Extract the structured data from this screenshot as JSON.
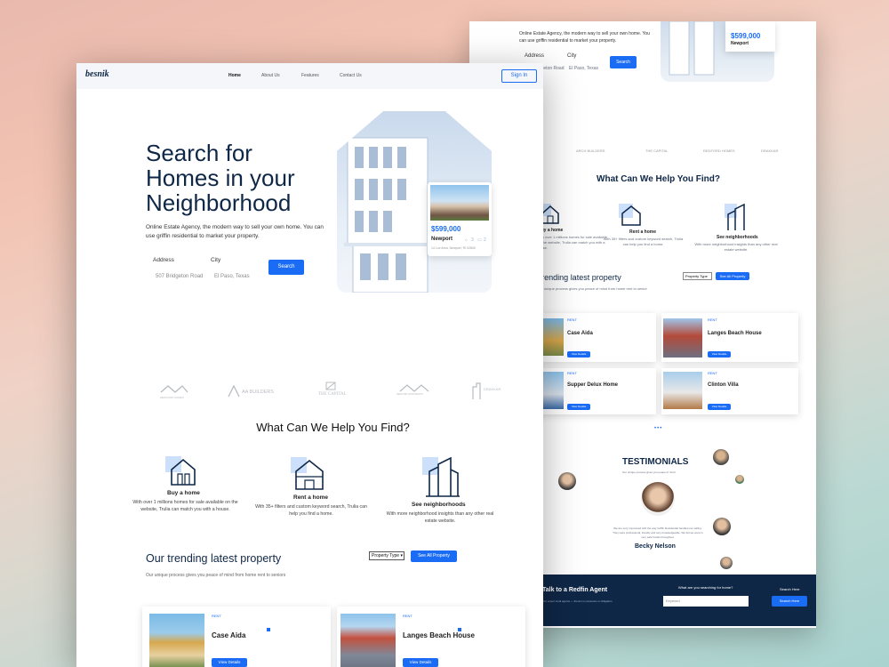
{
  "back": {
    "hero_text": "Online Estate Agency, the modern way to sell your own home. You can use griffin residential to market your property.",
    "address_label": "Address",
    "city_label": "City",
    "address_value": "507 Bridgeton Road",
    "city_value": "El Paso, Texas",
    "search_label": "Search",
    "price": "$599,000",
    "location": "Newport",
    "brands": [
      "ARCH BUILDERS",
      "THE CAPITAL",
      "REDFORD HOMES",
      "DRAKKAR"
    ],
    "help_title": "What Can We Help You Find?",
    "services": [
      {
        "title": "Buy a home",
        "desc": "With over 1 millions homes for sale available on the website, Trulia can match you with a house."
      },
      {
        "title": "Rent a home",
        "desc": "With 35+ filters and custom keyword search, Trulia can help you find a home."
      },
      {
        "title": "See neighborhoods",
        "desc": "With more neighborhood insights than any other real estate website."
      }
    ],
    "trending_title": "Trending latest property",
    "trending_sub": "Our unique process gives you peace of mind from home rent to senior",
    "property_type": "Property Type",
    "see_all": "See All Property",
    "listings": [
      {
        "name": "Case Aida",
        "tag": "RENT",
        "btn": "View Details"
      },
      {
        "name": "Langes Beach House",
        "tag": "RENT",
        "btn": "View Details"
      },
      {
        "name": "Supper Delux Home",
        "tag": "RENT",
        "btn": "View Details"
      },
      {
        "name": "Clinton Villa",
        "tag": "RENT",
        "btn": "View Details"
      }
    ],
    "pager": "•••",
    "testimonials_title": "TESTIMONIALS",
    "testimonials_sub": "Our unique process gives you peace of mind",
    "testimonial_quote": "We are very impressed with the way Griffin Residential handled our selling. They were professional, friendly and very knowledgeable. We felt we were in very safe hands throughout.",
    "testimonial_name": "Becky Nelson",
    "cta_title": "Talk to a Redfin Agent",
    "cta_sub": "Our expert local agents — there's no pressure or obligation.",
    "cta_question": "What are you searching for home?",
    "cta_placeholder": "Keyword",
    "cta_search_label": "Search Here",
    "cta_button": "Search Here"
  },
  "front": {
    "logo": "besnik",
    "nav": [
      "Home",
      "About Us",
      "Features",
      "Contact Us"
    ],
    "sign_in": "Sign In",
    "hero_title_1": "Search for",
    "hero_title_2": "Homes in your",
    "hero_title_3": "Neighborhood",
    "hero_text": "Online Estate Agency, the modern way to sell your own home. You can use griffin residential to market your property.",
    "address_label": "Address",
    "city_label": "City",
    "address_value": "507 Bridgeton Road",
    "city_value": "El Paso, Texas",
    "search_label": "Search",
    "price": "$599,000",
    "location": "Newport",
    "property_address": "14 Lux Area, Newport, RI 02840",
    "beds": "3",
    "baths": "2",
    "brands": [
      "REDFORD HOMES",
      "AA BUILDERS",
      "THE CAPITAL",
      "REDFORD APARTMENTS",
      "DRAKKAR"
    ],
    "help_title": "What Can We Help You Find?",
    "services": [
      {
        "title": "Buy a home",
        "desc": "With over 1 millions homes for sale available on the website, Trulia can match you with a house."
      },
      {
        "title": "Rent a home",
        "desc": "With 35+ filters and custom keyword search, Trulia can help you find a home."
      },
      {
        "title": "See neighborhoods",
        "desc": "With more neighborhood insights than any other real estate website."
      }
    ],
    "trending_title": "Our trending latest property",
    "trending_sub": "Our unique process gives you peace of mind from home rent to seniors",
    "property_type": "Property Type",
    "see_all": "See All Property",
    "listings": [
      {
        "name": "Case Aida",
        "tag": "RENT",
        "btn": "View Details"
      },
      {
        "name": "Langes Beach House",
        "tag": "RENT",
        "btn": "View Details"
      }
    ]
  },
  "colors": {
    "accent": "#1a6cf5",
    "navy": "#0f2747",
    "light_blue": "#d6e6fb"
  }
}
